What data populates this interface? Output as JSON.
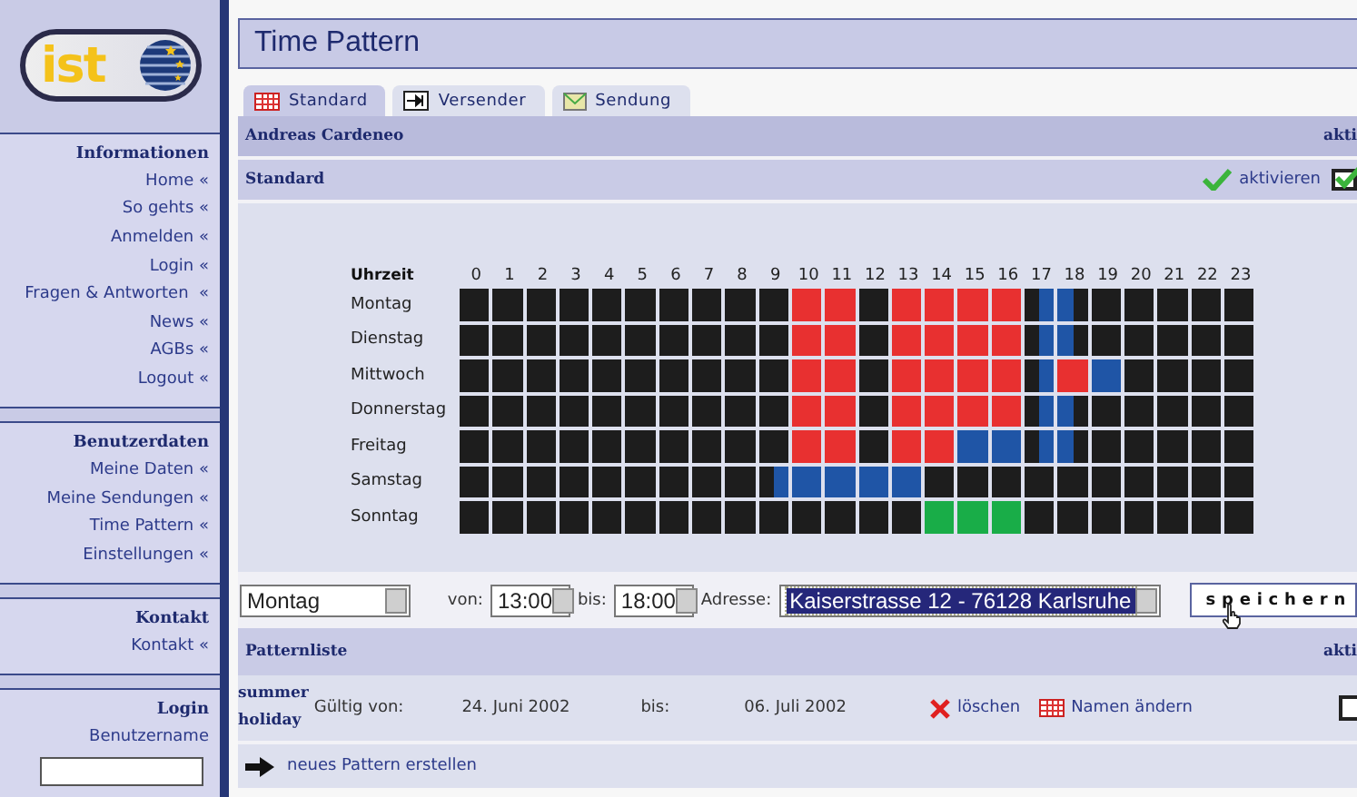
{
  "sidebar": {
    "logo_text": "ist",
    "sections": [
      {
        "heading": "Informationen",
        "links": [
          "Home «",
          "So gehts «",
          "Anmelden «",
          "Login «",
          "Fragen & Antworten  «",
          "News «",
          "AGBs «",
          "Logout «"
        ]
      },
      {
        "heading": "Benutzerdaten",
        "links": [
          "Meine Daten «",
          "Meine Sendungen «",
          "Time Pattern «",
          "Einstellungen «"
        ]
      },
      {
        "heading": "Kontakt",
        "links": [
          "Kontakt «"
        ]
      }
    ],
    "login": {
      "heading": "Login",
      "field_label": "Benutzername"
    }
  },
  "page_title": "Time Pattern",
  "tabs": [
    {
      "label": "Standard",
      "kind": "grid",
      "selected": true
    },
    {
      "label": "Versender",
      "kind": "arrow",
      "selected": false
    },
    {
      "label": "Sendung",
      "kind": "mail",
      "selected": false
    }
  ],
  "user_bar": {
    "name": "Andreas Cardeneo",
    "column": "akti"
  },
  "pattern_bar": {
    "name": "Standard",
    "action": "aktivieren",
    "checked": true
  },
  "schedule": {
    "corner": "Uhrzeit",
    "hours": [
      "0",
      "1",
      "2",
      "3",
      "4",
      "5",
      "6",
      "7",
      "8",
      "9",
      "10",
      "11",
      "12",
      "13",
      "14",
      "15",
      "16",
      "17",
      "18",
      "19",
      "20",
      "21",
      "22",
      "23"
    ],
    "rows": [
      {
        "day": "Montag",
        "cells": [
          {
            "color": "#1d1d1d"
          },
          {
            "color": "#1d1d1d"
          },
          {
            "color": "#1d1d1d"
          },
          {
            "color": "#1d1d1d"
          },
          {
            "color": "#1d1d1d"
          },
          {
            "color": "#1d1d1d"
          },
          {
            "color": "#1d1d1d"
          },
          {
            "color": "#1d1d1d"
          },
          {
            "color": "#1d1d1d"
          },
          {
            "color": "#1d1d1d"
          },
          {
            "color": "#e83030"
          },
          {
            "color": "#e83030"
          },
          {
            "color": "#1d1d1d"
          },
          {
            "color": "#e83030"
          },
          {
            "color": "#e83030"
          },
          {
            "color": "#e83030"
          },
          {
            "color": "#e83030"
          },
          {
            "halves": [
              {
                "color": "#1d1d1d"
              },
              {
                "color": "#1f55a6"
              }
            ]
          },
          {
            "halves": [
              {
                "color": "#1f55a6"
              },
              {
                "color": "#1d1d1d"
              }
            ]
          },
          {
            "color": "#1d1d1d"
          },
          {
            "color": "#1d1d1d"
          },
          {
            "color": "#1d1d1d"
          },
          {
            "color": "#1d1d1d"
          },
          {
            "color": "#1d1d1d"
          }
        ]
      },
      {
        "day": "Dienstag",
        "cells": [
          {
            "color": "#1d1d1d"
          },
          {
            "color": "#1d1d1d"
          },
          {
            "color": "#1d1d1d"
          },
          {
            "color": "#1d1d1d"
          },
          {
            "color": "#1d1d1d"
          },
          {
            "color": "#1d1d1d"
          },
          {
            "color": "#1d1d1d"
          },
          {
            "color": "#1d1d1d"
          },
          {
            "color": "#1d1d1d"
          },
          {
            "color": "#1d1d1d"
          },
          {
            "color": "#e83030"
          },
          {
            "color": "#e83030"
          },
          {
            "color": "#1d1d1d"
          },
          {
            "color": "#e83030"
          },
          {
            "color": "#e83030"
          },
          {
            "color": "#e83030"
          },
          {
            "color": "#e83030"
          },
          {
            "halves": [
              {
                "color": "#1d1d1d"
              },
              {
                "color": "#1f55a6"
              }
            ]
          },
          {
            "halves": [
              {
                "color": "#1f55a6"
              },
              {
                "color": "#1d1d1d"
              }
            ]
          },
          {
            "color": "#1d1d1d"
          },
          {
            "color": "#1d1d1d"
          },
          {
            "color": "#1d1d1d"
          },
          {
            "color": "#1d1d1d"
          },
          {
            "color": "#1d1d1d"
          }
        ]
      },
      {
        "day": "Mittwoch",
        "cells": [
          {
            "color": "#1d1d1d"
          },
          {
            "color": "#1d1d1d"
          },
          {
            "color": "#1d1d1d"
          },
          {
            "color": "#1d1d1d"
          },
          {
            "color": "#1d1d1d"
          },
          {
            "color": "#1d1d1d"
          },
          {
            "color": "#1d1d1d"
          },
          {
            "color": "#1d1d1d"
          },
          {
            "color": "#1d1d1d"
          },
          {
            "color": "#1d1d1d"
          },
          {
            "color": "#e83030"
          },
          {
            "color": "#e83030"
          },
          {
            "color": "#1d1d1d"
          },
          {
            "color": "#e83030"
          },
          {
            "color": "#e83030"
          },
          {
            "color": "#e83030"
          },
          {
            "color": "#e83030"
          },
          {
            "halves": [
              {
                "color": "#1d1d1d"
              },
              {
                "color": "#1f55a6"
              }
            ]
          },
          {
            "color": "#e83030"
          },
          {
            "color": "#1f55a6"
          },
          {
            "color": "#1d1d1d"
          },
          {
            "color": "#1d1d1d"
          },
          {
            "color": "#1d1d1d"
          },
          {
            "color": "#1d1d1d"
          }
        ]
      },
      {
        "day": "Donnerstag",
        "cells": [
          {
            "color": "#1d1d1d"
          },
          {
            "color": "#1d1d1d"
          },
          {
            "color": "#1d1d1d"
          },
          {
            "color": "#1d1d1d"
          },
          {
            "color": "#1d1d1d"
          },
          {
            "color": "#1d1d1d"
          },
          {
            "color": "#1d1d1d"
          },
          {
            "color": "#1d1d1d"
          },
          {
            "color": "#1d1d1d"
          },
          {
            "color": "#1d1d1d"
          },
          {
            "color": "#e83030"
          },
          {
            "color": "#e83030"
          },
          {
            "color": "#1d1d1d"
          },
          {
            "color": "#e83030"
          },
          {
            "color": "#e83030"
          },
          {
            "color": "#e83030"
          },
          {
            "color": "#e83030"
          },
          {
            "halves": [
              {
                "color": "#1d1d1d"
              },
              {
                "color": "#1f55a6"
              }
            ]
          },
          {
            "halves": [
              {
                "color": "#1f55a6"
              },
              {
                "color": "#1d1d1d"
              }
            ]
          },
          {
            "color": "#1d1d1d"
          },
          {
            "color": "#1d1d1d"
          },
          {
            "color": "#1d1d1d"
          },
          {
            "color": "#1d1d1d"
          },
          {
            "color": "#1d1d1d"
          }
        ]
      },
      {
        "day": "Freitag",
        "cells": [
          {
            "color": "#1d1d1d"
          },
          {
            "color": "#1d1d1d"
          },
          {
            "color": "#1d1d1d"
          },
          {
            "color": "#1d1d1d"
          },
          {
            "color": "#1d1d1d"
          },
          {
            "color": "#1d1d1d"
          },
          {
            "color": "#1d1d1d"
          },
          {
            "color": "#1d1d1d"
          },
          {
            "color": "#1d1d1d"
          },
          {
            "color": "#1d1d1d"
          },
          {
            "color": "#e83030"
          },
          {
            "color": "#e83030"
          },
          {
            "color": "#1d1d1d"
          },
          {
            "color": "#e83030"
          },
          {
            "color": "#e83030"
          },
          {
            "color": "#1f55a6"
          },
          {
            "color": "#1f55a6"
          },
          {
            "halves": [
              {
                "color": "#1d1d1d"
              },
              {
                "color": "#1f55a6"
              }
            ]
          },
          {
            "halves": [
              {
                "color": "#1f55a6"
              },
              {
                "color": "#1d1d1d"
              }
            ]
          },
          {
            "color": "#1d1d1d"
          },
          {
            "color": "#1d1d1d"
          },
          {
            "color": "#1d1d1d"
          },
          {
            "color": "#1d1d1d"
          },
          {
            "color": "#1d1d1d"
          }
        ]
      },
      {
        "day": "Samstag",
        "cells": [
          {
            "color": "#1d1d1d"
          },
          {
            "color": "#1d1d1d"
          },
          {
            "color": "#1d1d1d"
          },
          {
            "color": "#1d1d1d"
          },
          {
            "color": "#1d1d1d"
          },
          {
            "color": "#1d1d1d"
          },
          {
            "color": "#1d1d1d"
          },
          {
            "color": "#1d1d1d"
          },
          {
            "color": "#1d1d1d"
          },
          {
            "halves": [
              {
                "color": "#1d1d1d"
              },
              {
                "color": "#1f55a6"
              }
            ]
          },
          {
            "color": "#1f55a6"
          },
          {
            "color": "#1f55a6"
          },
          {
            "color": "#1f55a6"
          },
          {
            "color": "#1f55a6"
          },
          {
            "color": "#1d1d1d"
          },
          {
            "color": "#1d1d1d"
          },
          {
            "color": "#1d1d1d"
          },
          {
            "color": "#1d1d1d"
          },
          {
            "color": "#1d1d1d"
          },
          {
            "color": "#1d1d1d"
          },
          {
            "color": "#1d1d1d"
          },
          {
            "color": "#1d1d1d"
          },
          {
            "color": "#1d1d1d"
          },
          {
            "color": "#1d1d1d"
          }
        ]
      },
      {
        "day": "Sonntag",
        "cells": [
          {
            "color": "#1d1d1d"
          },
          {
            "color": "#1d1d1d"
          },
          {
            "color": "#1d1d1d"
          },
          {
            "color": "#1d1d1d"
          },
          {
            "color": "#1d1d1d"
          },
          {
            "color": "#1d1d1d"
          },
          {
            "color": "#1d1d1d"
          },
          {
            "color": "#1d1d1d"
          },
          {
            "color": "#1d1d1d"
          },
          {
            "color": "#1d1d1d"
          },
          {
            "color": "#1d1d1d"
          },
          {
            "color": "#1d1d1d"
          },
          {
            "color": "#1d1d1d"
          },
          {
            "color": "#1d1d1d"
          },
          {
            "color": "#19ad48"
          },
          {
            "color": "#19ad48"
          },
          {
            "color": "#19ad48"
          },
          {
            "color": "#1d1d1d"
          },
          {
            "color": "#1d1d1d"
          },
          {
            "color": "#1d1d1d"
          },
          {
            "color": "#1d1d1d"
          },
          {
            "color": "#1d1d1d"
          },
          {
            "color": "#1d1d1d"
          },
          {
            "color": "#1d1d1d"
          }
        ]
      }
    ]
  },
  "controls": {
    "day": "Montag",
    "from_label": "von:",
    "from": "13:00",
    "to_label": "bis:",
    "to": "18:00",
    "address_label": "Adresse:",
    "address": "Kaiserstrasse 12 - 76128 Karlsruhe",
    "save": "speichern"
  },
  "pattern_list": {
    "title": "Patternliste",
    "column": "akti",
    "rows": [
      {
        "name": "summer holiday",
        "valid_from_label": "Gültig von:",
        "from": "24. Juni 2002",
        "to_label": "bis:",
        "to": "06. Juli 2002",
        "delete": "löschen",
        "rename": "Namen ändern",
        "active": false
      }
    ],
    "new_pattern": "neues Pattern erstellen"
  }
}
